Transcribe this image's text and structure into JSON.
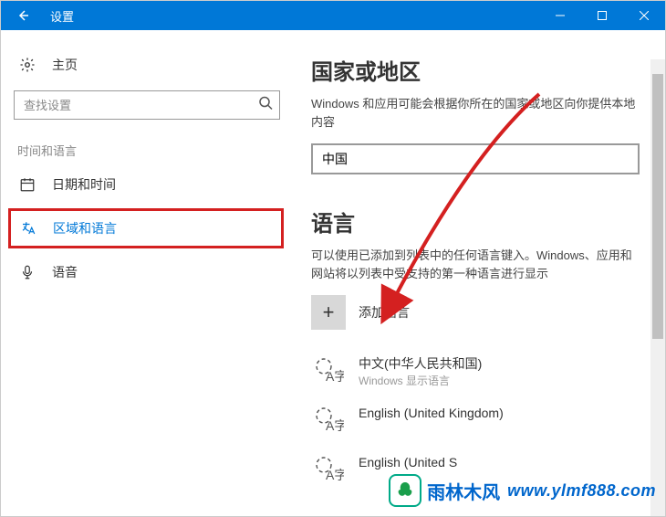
{
  "titlebar": {
    "title": "设置"
  },
  "sidebar": {
    "home_label": "主页",
    "search_placeholder": "查找设置",
    "group_label": "时间和语言",
    "items": [
      {
        "label": "日期和时间"
      },
      {
        "label": "区域和语言"
      },
      {
        "label": "语音"
      }
    ]
  },
  "content": {
    "region": {
      "heading": "国家或地区",
      "desc": "Windows 和应用可能会根据你所在的国家或地区向你提供本地内容",
      "selected": "中国"
    },
    "language": {
      "heading": "语言",
      "desc": "可以使用已添加到列表中的任何语言键入。Windows、应用和网站将以列表中受支持的第一种语言进行显示",
      "add_button": "添加语言",
      "items": [
        {
          "name": "中文(中华人民共和国)",
          "sub": "Windows 显示语言",
          "glyph": "A字"
        },
        {
          "name": "English (United Kingdom)",
          "sub": "",
          "glyph": "A字"
        },
        {
          "name": "English (United S",
          "sub": "",
          "glyph": "A字"
        }
      ]
    }
  },
  "watermark": {
    "brand_cn": "雨林木风",
    "url": "www.ylmf888.com"
  }
}
